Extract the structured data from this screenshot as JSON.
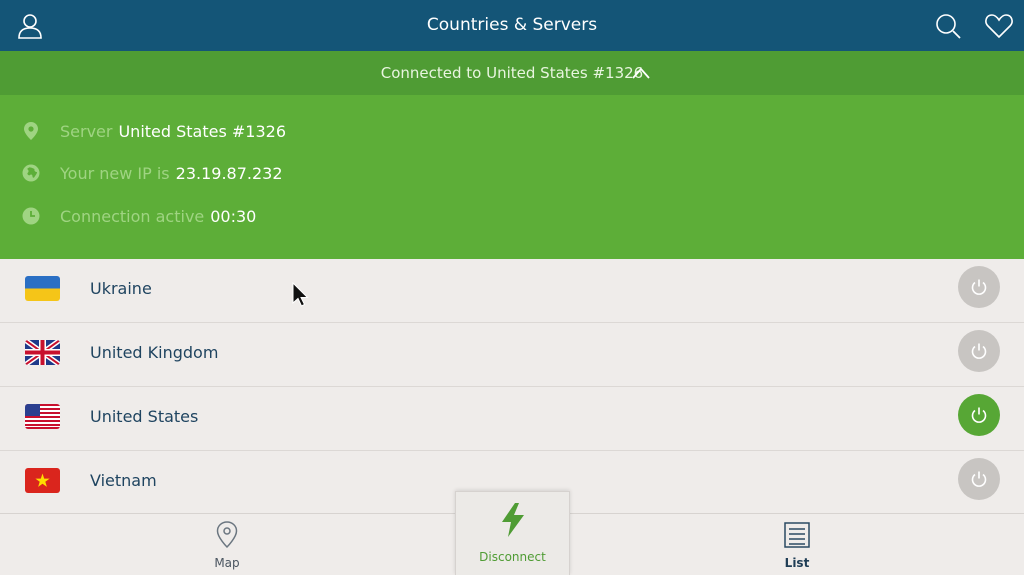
{
  "header": {
    "title": "Countries & Servers",
    "icons": [
      "user-icon",
      "search-icon",
      "heart-icon"
    ]
  },
  "connection": {
    "banner": "Connected to United States #1326",
    "server_label": "Server",
    "server_value": "United States #1326",
    "ip_label": "Your new IP is",
    "ip_value": "23.19.87.232",
    "active_label": "Connection active",
    "active_value": "00:30"
  },
  "countries": [
    {
      "name": "Ukraine",
      "flag": "ukraine-flag",
      "active": false
    },
    {
      "name": "United Kingdom",
      "flag": "uk-flag",
      "active": false
    },
    {
      "name": "United States",
      "flag": "us-flag",
      "active": true
    },
    {
      "name": "Vietnam",
      "flag": "vietnam-flag",
      "active": false
    }
  ],
  "tabs": {
    "map": "Map",
    "disconnect": "Disconnect",
    "list": "List"
  },
  "colors": {
    "header": "#145577",
    "connected_green": "#5dae38",
    "banner_green": "#4f9c34",
    "inactive_power": "#c8c5c2"
  }
}
